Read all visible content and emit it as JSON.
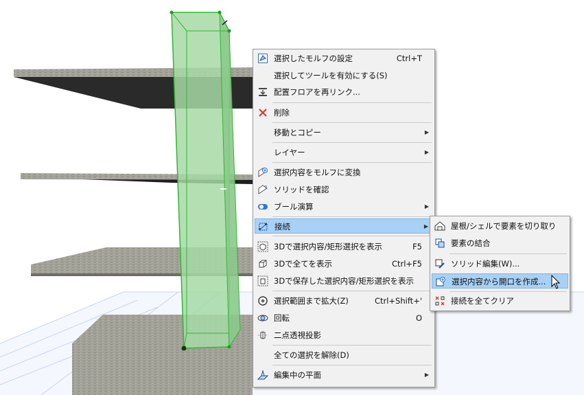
{
  "context_menu": {
    "items": [
      {
        "label": "選択したモルフの設定",
        "shortcut": "Ctrl+T",
        "icon": "morph-settings-icon"
      },
      {
        "label": "選択してツールを有効にする(S)",
        "shortcut": "",
        "icon": ""
      },
      {
        "label": "配置フロアを再リンク...",
        "shortcut": "",
        "icon": "floor-relink-icon"
      },
      {
        "label": "削除",
        "shortcut": "",
        "icon": "delete-icon"
      },
      {
        "label": "移動とコピー",
        "shortcut": "",
        "icon": ""
      },
      {
        "label": "レイヤー",
        "shortcut": "",
        "icon": ""
      },
      {
        "label": "選択内容をモルフに変換",
        "shortcut": "",
        "icon": "convert-morph-icon"
      },
      {
        "label": "ソリッドを確認",
        "shortcut": "",
        "icon": "check-solid-icon"
      },
      {
        "label": "ブール演算",
        "shortcut": "",
        "icon": "boolean-icon"
      },
      {
        "label": "接続",
        "shortcut": "",
        "icon": "connect-icon"
      },
      {
        "label": "3Dで選択内容/矩形選択を表示",
        "shortcut": "F5",
        "icon": "show-selection-3d-icon"
      },
      {
        "label": "3Dで全てを表示",
        "shortcut": "Ctrl+F5",
        "icon": "show-all-3d-icon"
      },
      {
        "label": "3Dで保存した選択内容/矩形選択を表示",
        "shortcut": "",
        "icon": "show-saved-3d-icon"
      },
      {
        "label": "選択範囲まで拡大(Z)",
        "shortcut": "Ctrl+Shift+'",
        "icon": "zoom-selection-icon"
      },
      {
        "label": "回転",
        "shortcut": "O",
        "icon": "orbit-icon"
      },
      {
        "label": "二点透視投影",
        "shortcut": "",
        "icon": "two-point-perspective-icon"
      },
      {
        "label": "全ての選択を解除(D)",
        "shortcut": "",
        "icon": ""
      },
      {
        "label": "編集中の平面",
        "shortcut": "",
        "icon": "editing-plane-icon"
      }
    ]
  },
  "submenu": {
    "items": [
      {
        "label": "屋根/シェルで要素を切り取り",
        "icon": "trim-roof-icon"
      },
      {
        "label": "要素の結合",
        "icon": "merge-elements-icon"
      },
      {
        "label": "ソリッド編集(W)...",
        "icon": "solid-edit-icon"
      },
      {
        "label": "選択内容から開口を作成...",
        "icon": "create-opening-icon"
      },
      {
        "label": "接続を全てクリア",
        "icon": "clear-connections-icon"
      }
    ]
  },
  "colors": {
    "menu_bg": "#f1f1f1",
    "highlight": "#a9d1f5",
    "selection_green": "#5fc25f",
    "delete_red": "#e0352b"
  }
}
